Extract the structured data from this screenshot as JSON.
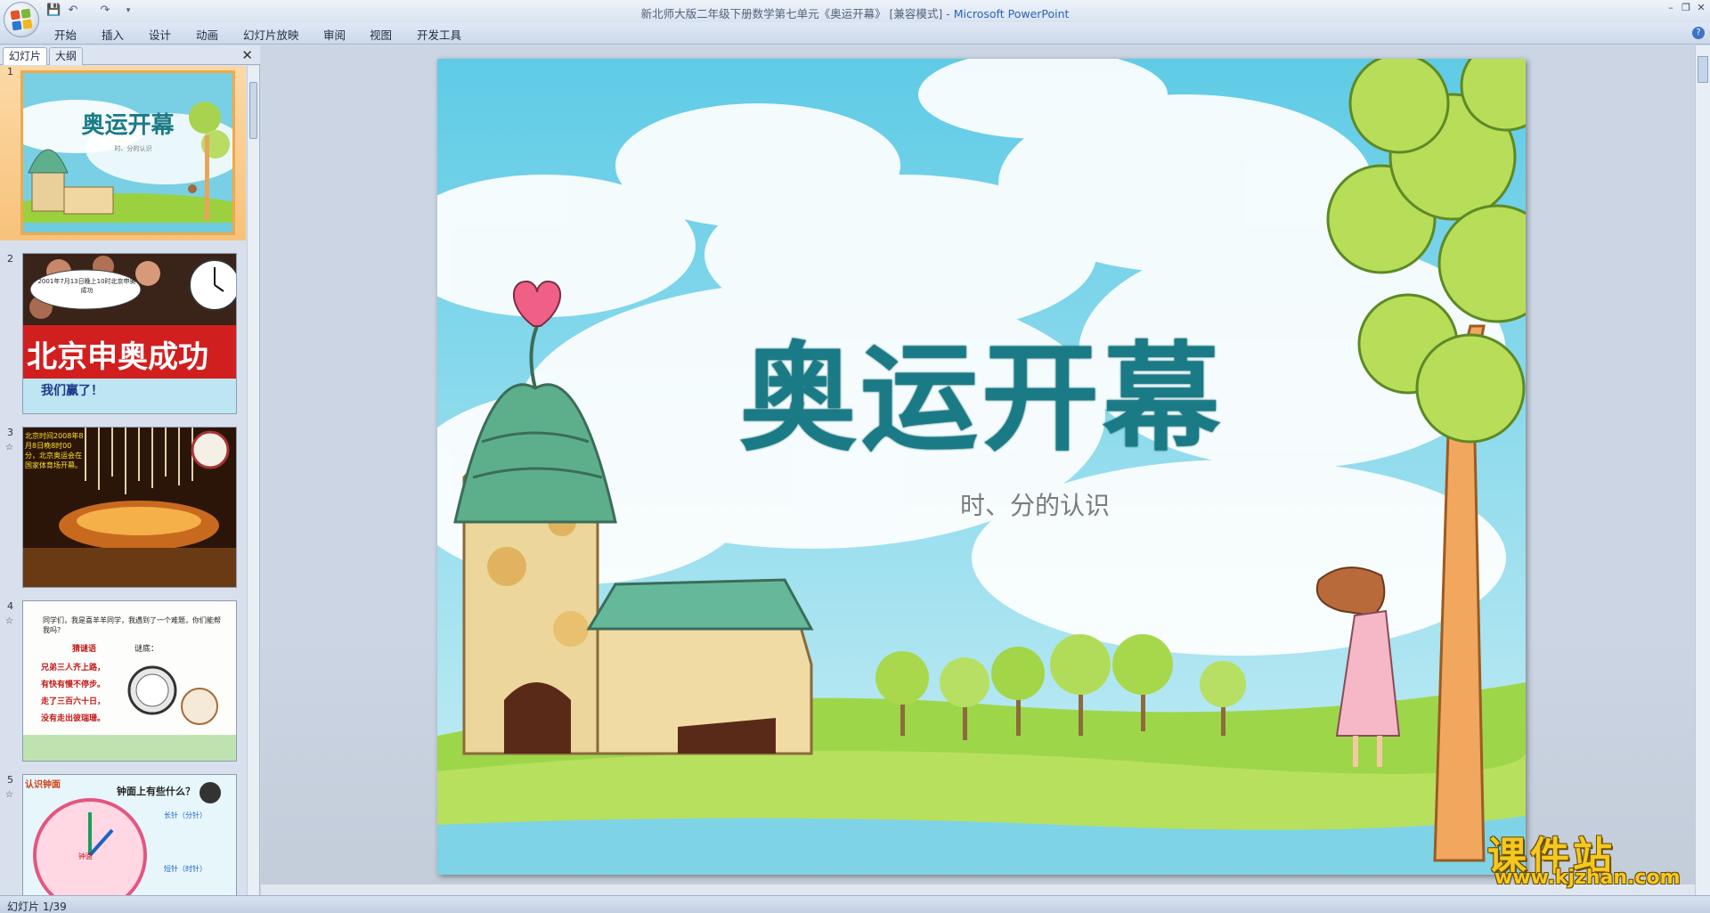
{
  "window": {
    "title": "新北师大版二年级下册数学第七单元《奥运开幕》 [兼容模式] - ",
    "app_name": "Microsoft PowerPoint",
    "controls": [
      "minimize",
      "restore",
      "close"
    ]
  },
  "ribbon": {
    "tabs": [
      "开始",
      "插入",
      "设计",
      "动画",
      "幻灯片放映",
      "审阅",
      "视图",
      "开发工具"
    ]
  },
  "left_pane": {
    "tabs": [
      "幻灯片",
      "大纲"
    ],
    "active_tab": "幻灯片",
    "slides": [
      {
        "number": "1",
        "title": "奥运开幕",
        "subtitle": "时、分的认识",
        "has_animation": false,
        "selected": true
      },
      {
        "number": "2",
        "caption": "2001年7月13日晚上10时北京申奥成功",
        "banner": "北京申奥成功",
        "footer": "我们赢了！",
        "has_animation": false
      },
      {
        "number": "3",
        "text": "北京时间2008年8月8日晚8时00分，北京奥运会在国家体育场开幕。",
        "has_animation": true
      },
      {
        "number": "4",
        "intro": "同学们，我是喜羊羊同学，我遇到了一个难题，你们能帮我吗？",
        "riddle_label": "猜谜语",
        "answer_label": "谜底：",
        "riddle": [
          "兄弟三人齐上路，",
          "有快有慢不停步。",
          "走了三百六十日，",
          "没有走出彼瑞珊。"
        ],
        "has_animation": true
      },
      {
        "number": "5",
        "heading": "认识钟面",
        "question": "钟面上有些什么？",
        "labels": [
          "长针（分针）",
          "短针（时针）",
          "钟面"
        ],
        "has_animation": true
      }
    ]
  },
  "slide": {
    "title": "奥运开幕",
    "subtitle": "时、分的认识"
  },
  "statusbar": {
    "slide_indicator": "幻灯片 1/39"
  },
  "watermark": {
    "cn": "课件站",
    "url": "www.kjzhan.com"
  },
  "colors": {
    "title_teal": "#1a7b86",
    "selection_orange": "#f7c27a",
    "ribbon_bg": "#d9e3f0"
  }
}
